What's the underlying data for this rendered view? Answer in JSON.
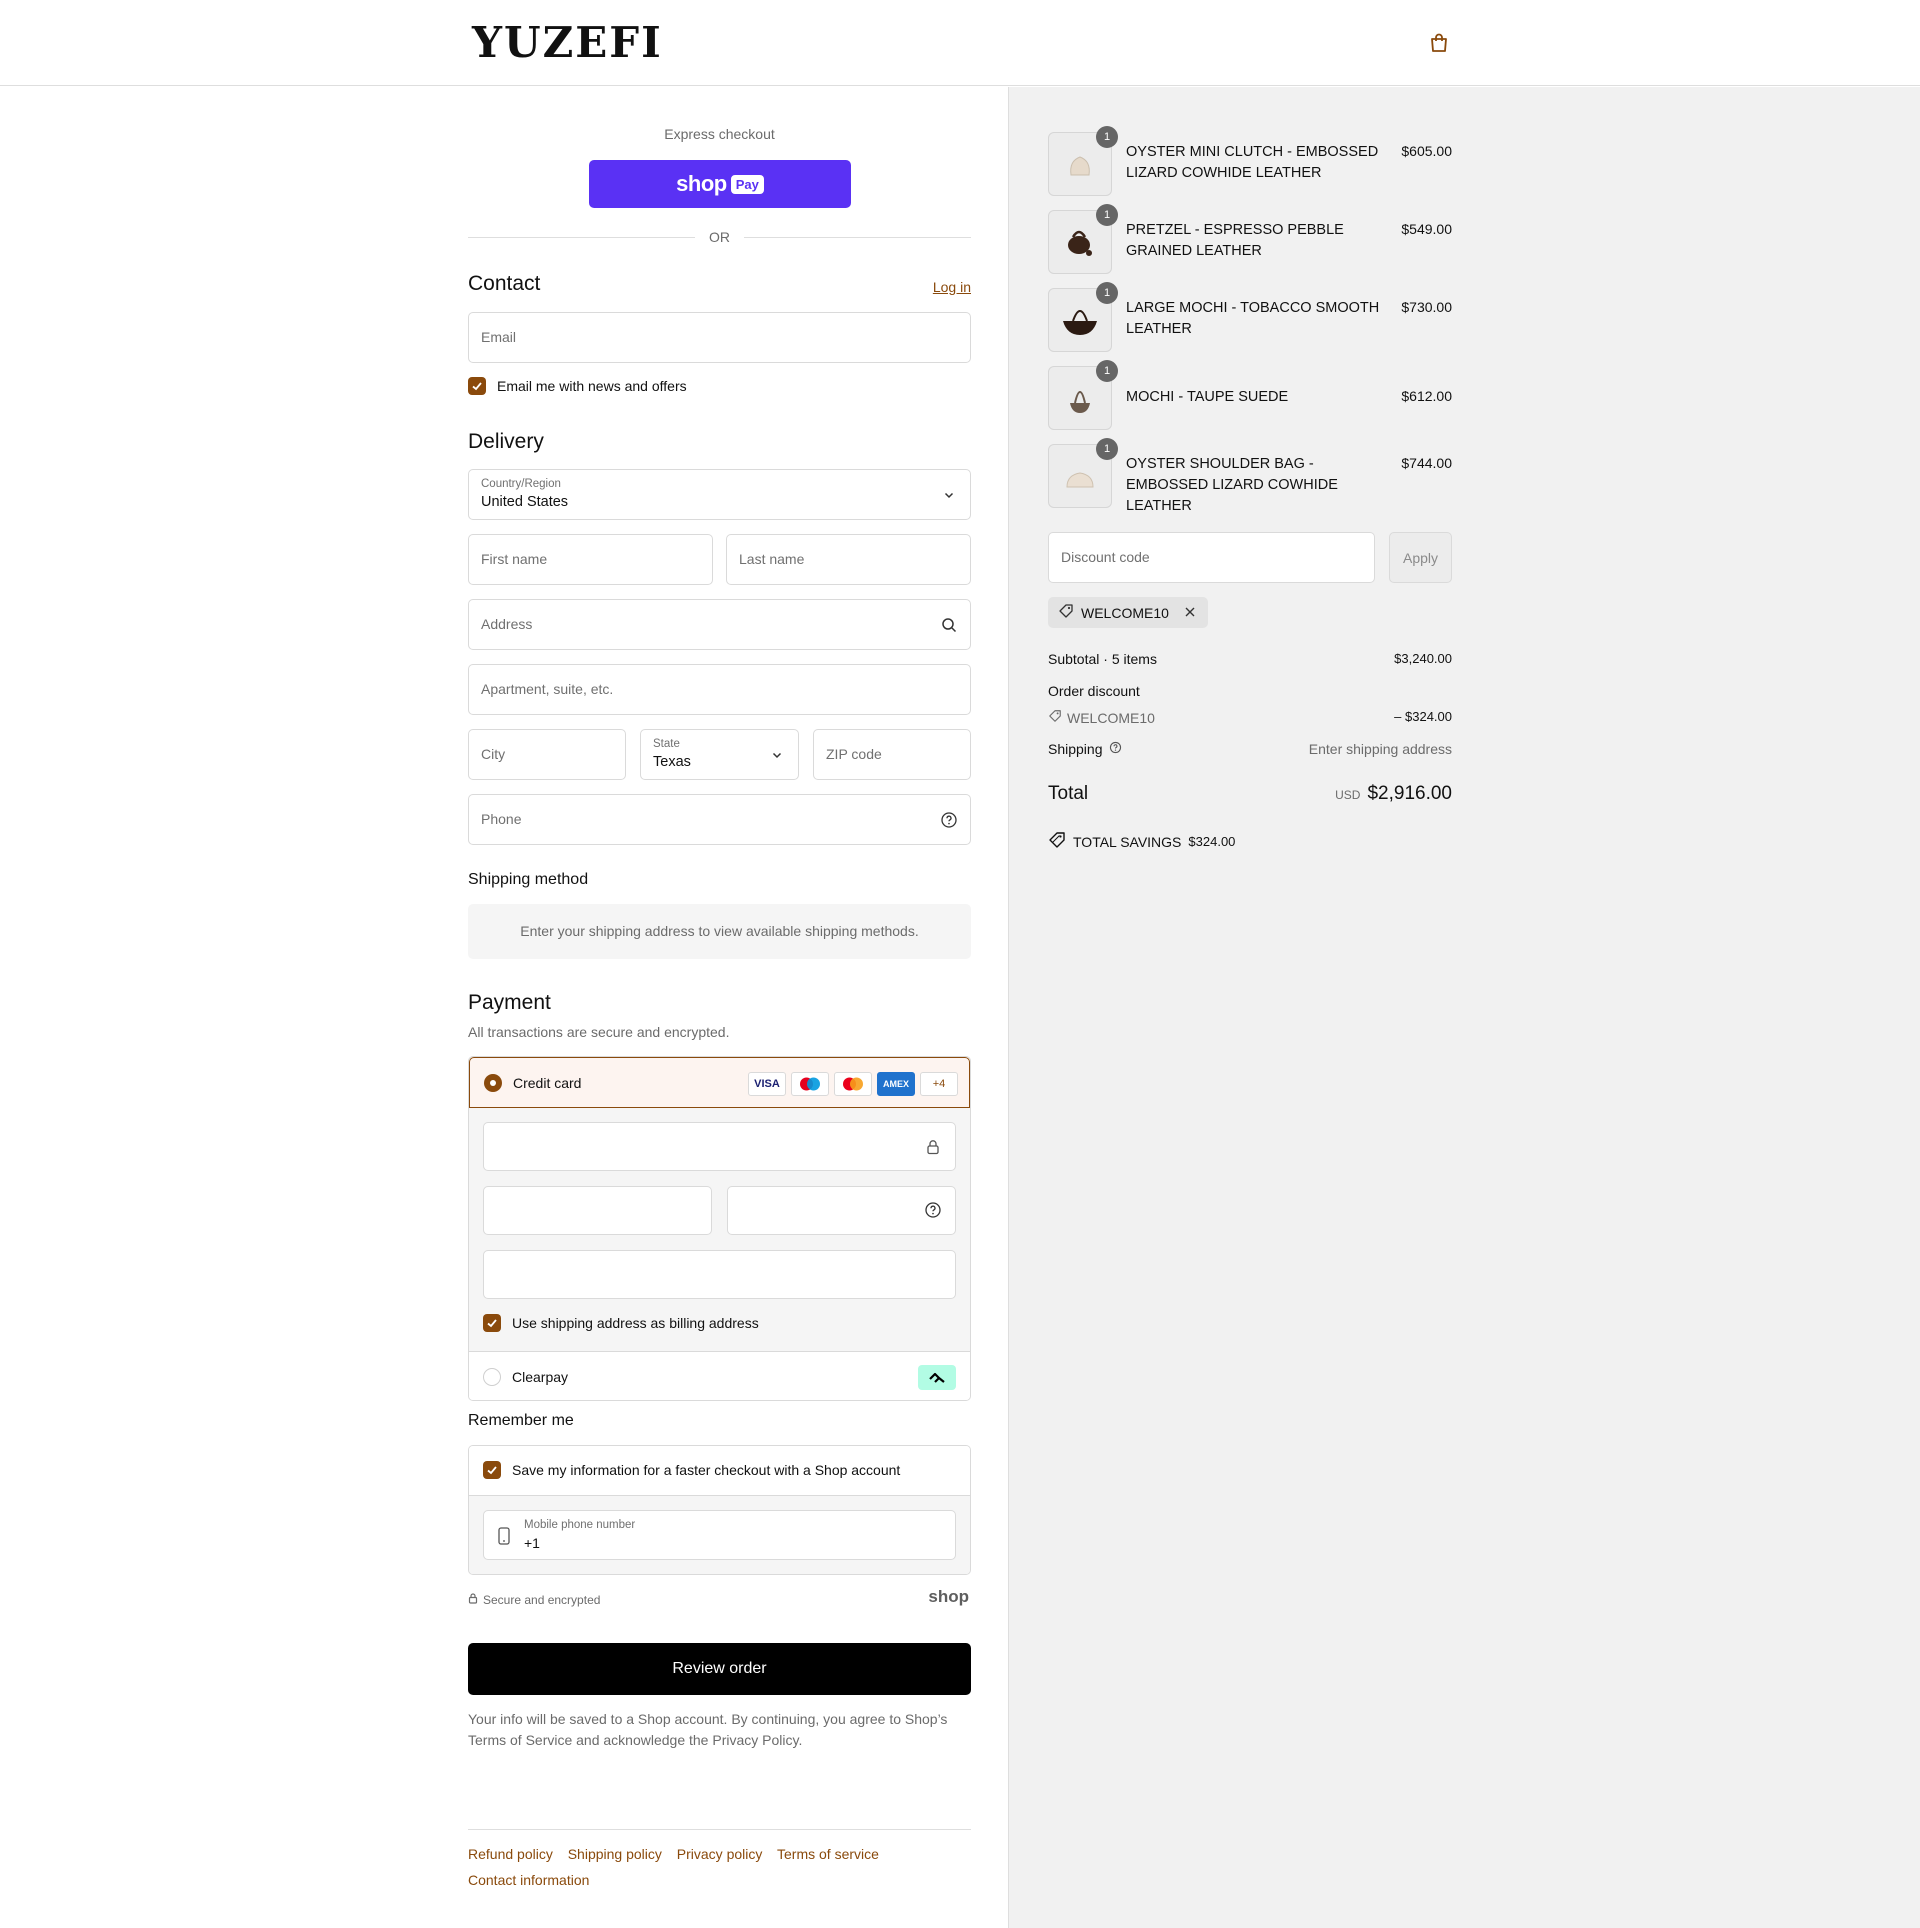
{
  "header": {
    "logo": "YUZEFI",
    "cart_icon": "shopping-bag-icon"
  },
  "express": {
    "label": "Express checkout",
    "shop_pay_text": "shop",
    "shop_pay_badge": "Pay",
    "or_label": "OR"
  },
  "contact": {
    "title": "Contact",
    "login_label": "Log in",
    "email_placeholder": "Email",
    "newsletter_label": "Email me with news and offers",
    "newsletter_checked": true
  },
  "delivery": {
    "title": "Delivery",
    "country_label": "Country/Region",
    "country_value": "United States",
    "first_name_placeholder": "First name",
    "last_name_placeholder": "Last name",
    "address_placeholder": "Address",
    "apartment_placeholder": "Apartment, suite, etc.",
    "city_placeholder": "City",
    "state_label": "State",
    "state_value": "Texas",
    "zip_placeholder": "ZIP code",
    "phone_placeholder": "Phone"
  },
  "shipping_method": {
    "title": "Shipping method",
    "message": "Enter your shipping address to view available shipping methods."
  },
  "payment": {
    "title": "Payment",
    "subtitle": "All transactions are secure and encrypted.",
    "credit_card_label": "Credit card",
    "card_brands": [
      "VISA",
      "Maestro",
      "Mastercard",
      "AMEX"
    ],
    "more_cards": "+4",
    "billing_same_label": "Use shipping address as billing address",
    "clearpay_label": "Clearpay",
    "accent": "#8a4a0c"
  },
  "remember": {
    "title": "Remember me",
    "save_label": "Save my information for a faster checkout with a Shop account",
    "mobile_label": "Mobile phone number",
    "mobile_value": "+1",
    "secure_label": "Secure and encrypted",
    "shop_logo": "shop"
  },
  "review": {
    "button_label": "Review order",
    "legal_prefix": "Your info will be saved to a Shop account. By continuing, you agree to Shop’s",
    "terms_label": "Terms of Service",
    "legal_middle": "and acknowledge the",
    "privacy_label": "Privacy Policy",
    "legal_suffix": "."
  },
  "footer": {
    "links": [
      "Refund policy",
      "Shipping policy",
      "Privacy policy",
      "Terms of service",
      "Contact information"
    ]
  },
  "cart": {
    "items": [
      {
        "name": "OYSTER MINI CLUTCH - EMBOSSED LIZARD COWHIDE LEATHER",
        "price": "$605.00",
        "qty": "1",
        "swatch": "#e8ddd0"
      },
      {
        "name": "PRETZEL - ESPRESSO PEBBLE GRAINED LEATHER",
        "price": "$549.00",
        "qty": "1",
        "swatch": "#3a2418"
      },
      {
        "name": "LARGE MOCHI - TOBACCO SMOOTH LEATHER",
        "price": "$730.00",
        "qty": "1",
        "swatch": "#2b1a12"
      },
      {
        "name": "MOCHI - TAUPE SUEDE",
        "price": "$612.00",
        "qty": "1",
        "swatch": "#6b5a4c"
      },
      {
        "name": "OYSTER SHOULDER BAG - EMBOSSED LIZARD COWHIDE LEATHER",
        "price": "$744.00",
        "qty": "1",
        "swatch": "#eadfd2"
      }
    ],
    "discount_placeholder": "Discount code",
    "apply_label": "Apply",
    "applied_code": "WELCOME10",
    "subtotal_label": "Subtotal · 5 items",
    "subtotal_value": "$3,240.00",
    "order_discount_label": "Order discount",
    "discount_code": "WELCOME10",
    "discount_value": "– $324.00",
    "shipping_label": "Shipping",
    "shipping_value": "Enter shipping address",
    "total_label": "Total",
    "currency": "USD",
    "total_value": "$2,916.00",
    "savings_label": "TOTAL SAVINGS",
    "savings_value": "$324.00"
  }
}
